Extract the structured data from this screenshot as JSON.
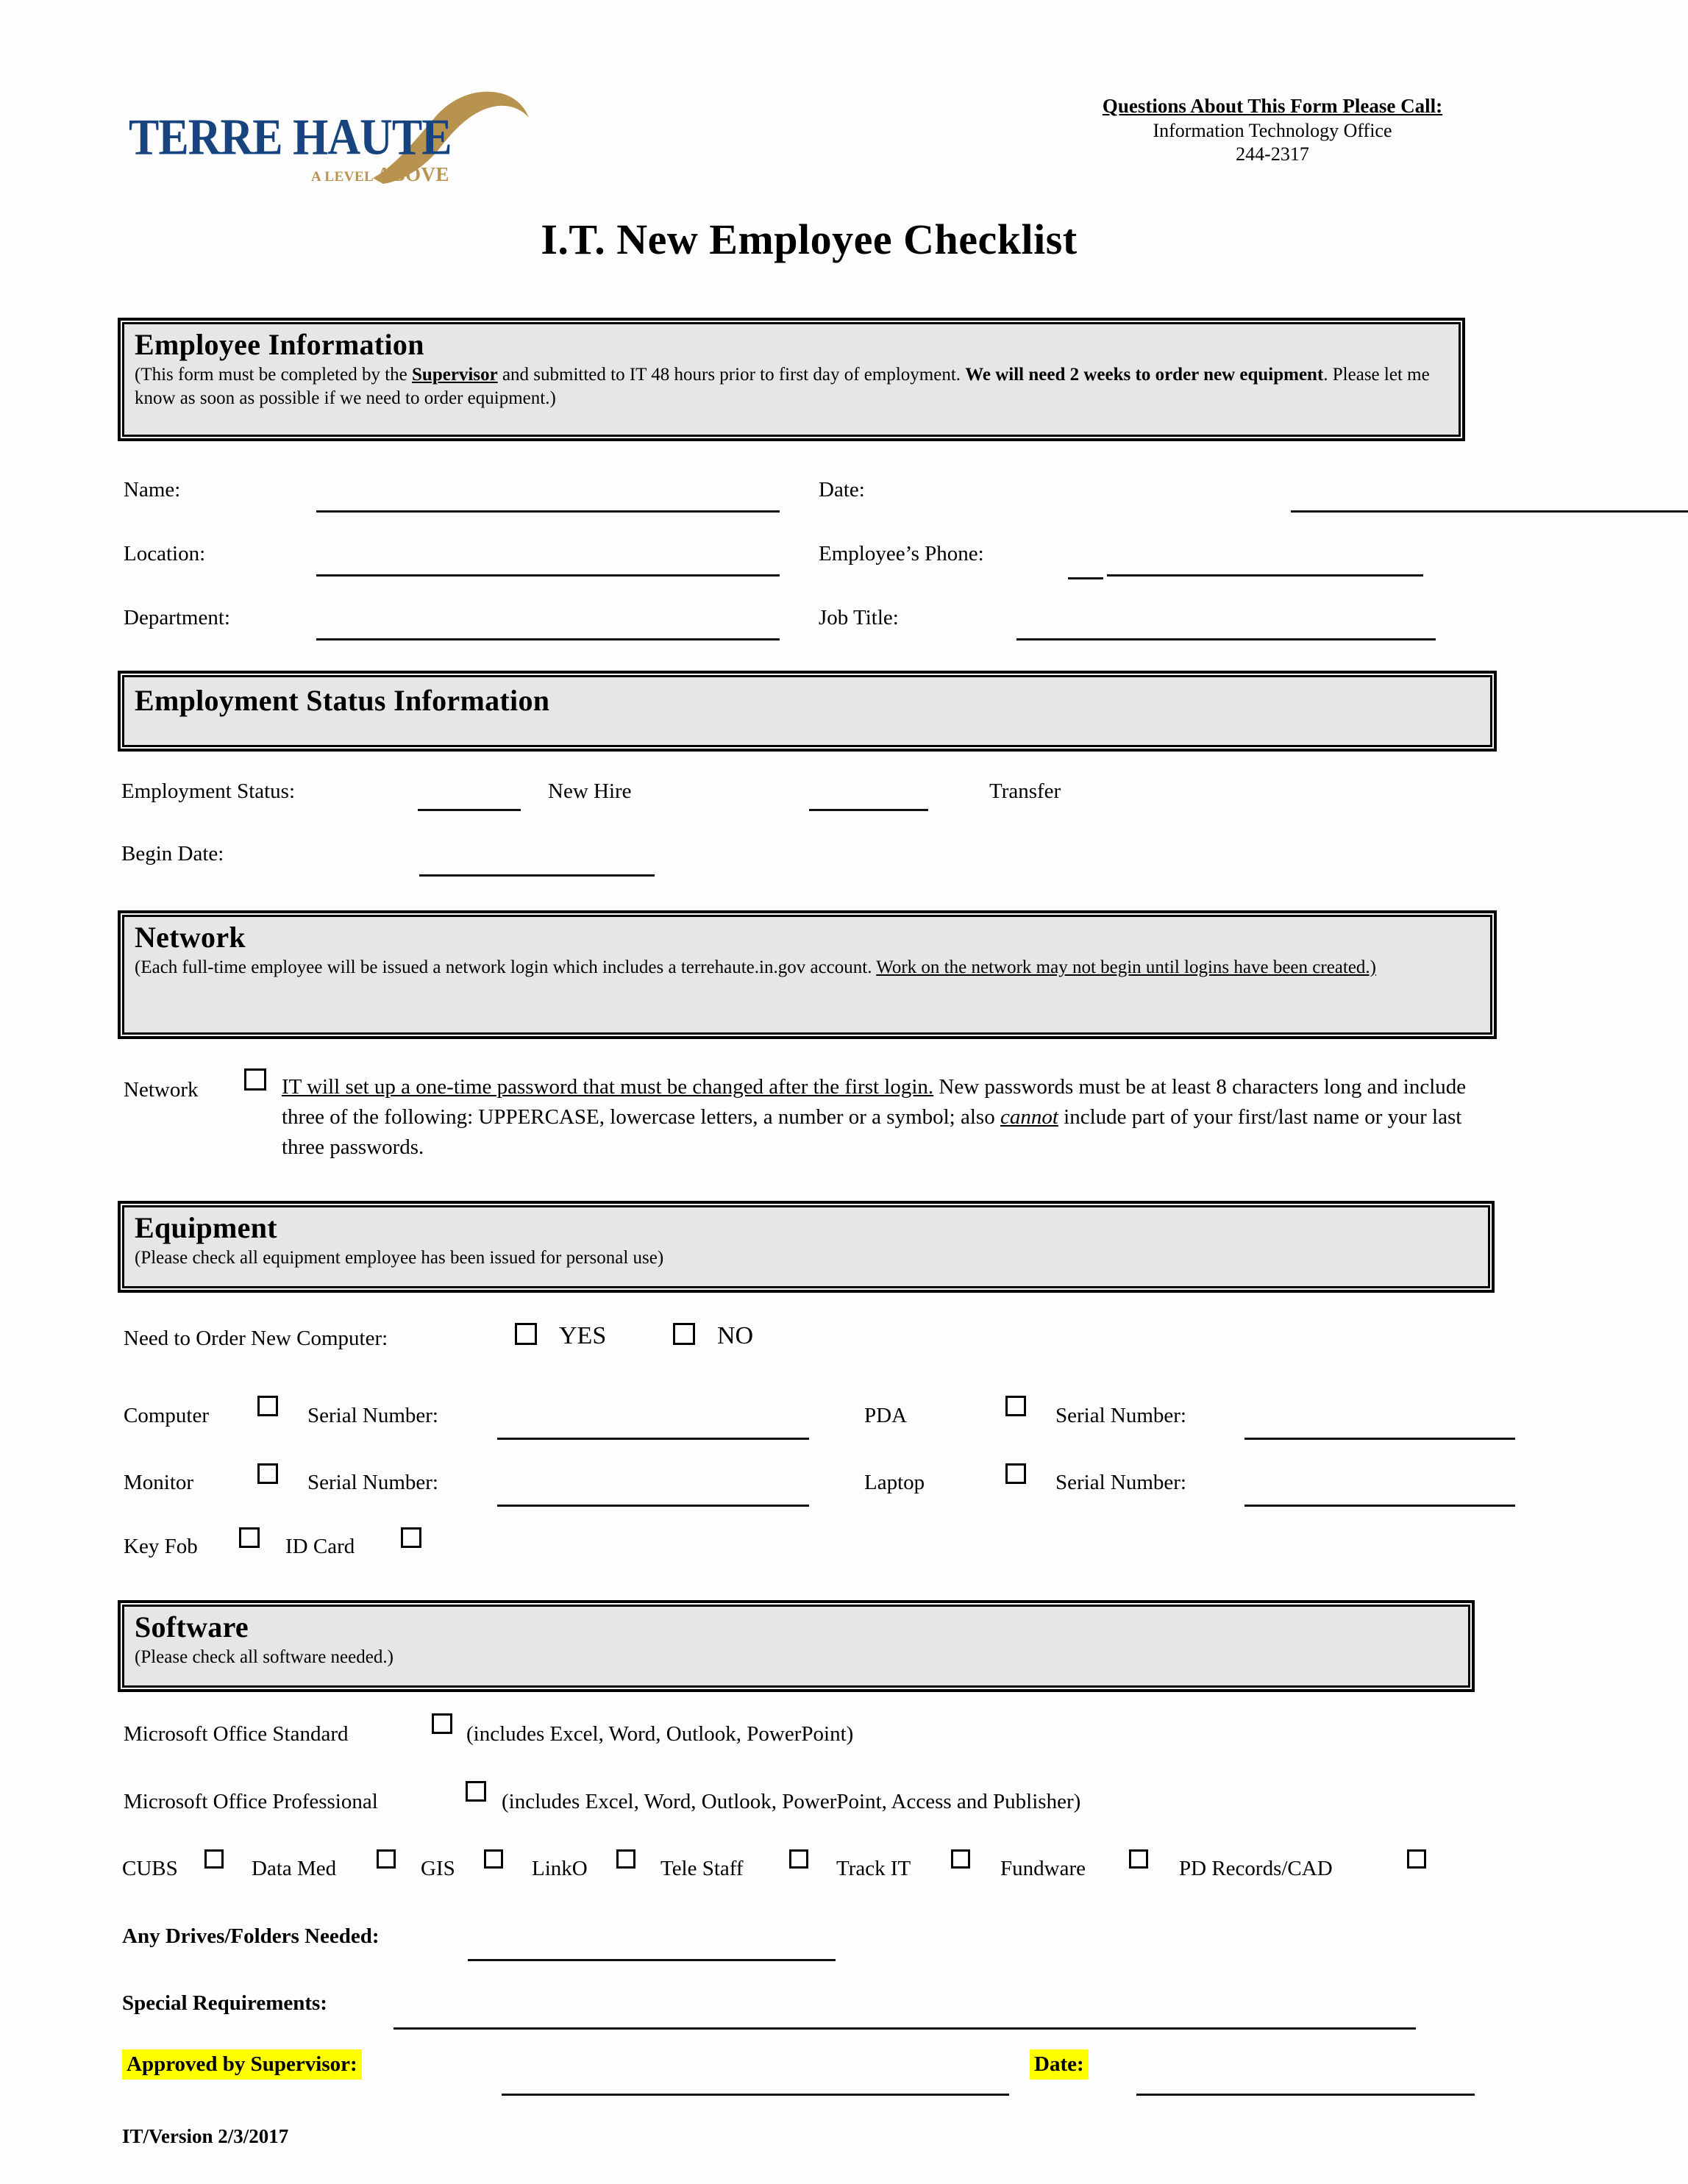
{
  "header": {
    "logo": {
      "name_text": "TERRE HAUTE",
      "tagline_small": "A LEVEL ",
      "tagline_big": "ABOVE",
      "navy": "#17447e",
      "gold": "#b8934f"
    },
    "contact": {
      "line1": "Questions About This Form Please Call:",
      "line2": "Information Technology Office",
      "line3": "244-2317"
    }
  },
  "title": "I.T. New Employee Checklist",
  "employee_information": {
    "heading": "Employee Information",
    "note_part1": "(This form must be completed by the ",
    "note_supervisor": "Supervisor",
    "note_part2": " and submitted to IT 48 hours prior to first day of employment. ",
    "note_bold1": "We will need 2 weeks to order new equipment",
    "note_part3": ". Please let me know as soon as possible if we need to order equipment.)",
    "fields": {
      "name": "Name:",
      "date": "Date:",
      "location": "Location:",
      "phone": "Employee’s Phone:",
      "department": "Department:",
      "job_title": "Job Title:"
    }
  },
  "employment_status": {
    "heading": "Employment Status Information",
    "status_label": "Employment Status:",
    "new_hire": "New Hire",
    "transfer": "Transfer",
    "begin_date": "Begin Date:"
  },
  "network": {
    "heading": "Network",
    "note_part1": "(Each full-time employee will be issued a network login which includes a terrehaute.in.gov account. ",
    "note_underline": "Work on the network may not begin until logins have been created.)",
    "row_label": "Network",
    "body_underline": "IT will set up a one-time password that must be changed after the first login.",
    "body_rest1": "  New passwords must be at least 8 characters long and include three of the following: UPPERCASE, lowercase letters, a number or a symbol; also ",
    "body_italic": "cannot",
    "body_rest2": " include part of your first/last name or your last three passwords."
  },
  "equipment": {
    "heading": "Equipment",
    "note": "(Please check all equipment employee has been issued for personal use)",
    "order_label": "Need to Order New Computer:",
    "yes": "YES",
    "no": "NO",
    "serial_label": "Serial Number:",
    "items": {
      "computer": "Computer",
      "pda": "PDA",
      "monitor": "Monitor",
      "laptop": "Laptop",
      "key_fob": "Key Fob",
      "id_card": "ID Card"
    }
  },
  "software": {
    "heading": "Software",
    "note": "(Please check all software needed.)",
    "office_standard": "Microsoft Office Standard",
    "office_standard_desc": "(includes Excel, Word, Outlook, PowerPoint)",
    "office_professional": "Microsoft Office Professional",
    "office_professional_desc": "(includes Excel, Word, Outlook, PowerPoint, Access and Publisher)",
    "apps": [
      "CUBS",
      "Data Med",
      "GIS",
      "LinkO",
      "Tele Staff",
      "Track IT",
      "Fundware",
      "PD Records/CAD"
    ]
  },
  "footer": {
    "drives_label": "Any Drives/Folders Needed:",
    "special_label": "Special Requirements:",
    "approved_label": "Approved by Supervisor:",
    "date_label": "Date:",
    "version": "IT/Version 2/3/2017",
    "highlight_color": "#ffff00"
  }
}
